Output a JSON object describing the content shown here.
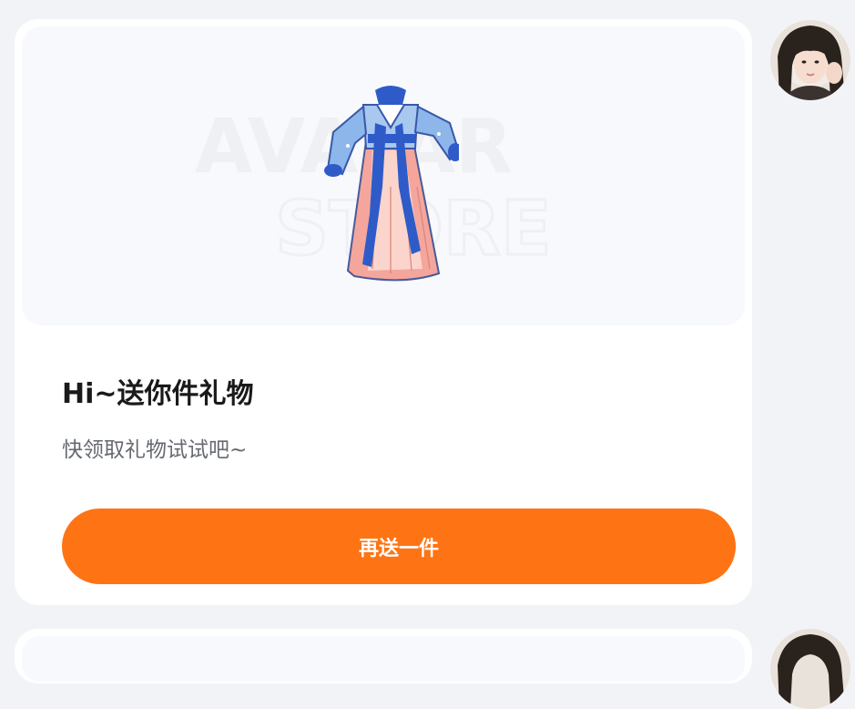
{
  "gift_card": {
    "title": "Hi~送你件礼物",
    "subtitle": "快领取礼物试试吧~",
    "button_label": "再送一件",
    "watermark_line1": "AVATAR",
    "watermark_line2": "STORE",
    "accent_color": "#fe7414",
    "item_icon": "hanfu-robe-icon"
  },
  "sender": {
    "avatar_icon": "user-avatar-photo"
  }
}
